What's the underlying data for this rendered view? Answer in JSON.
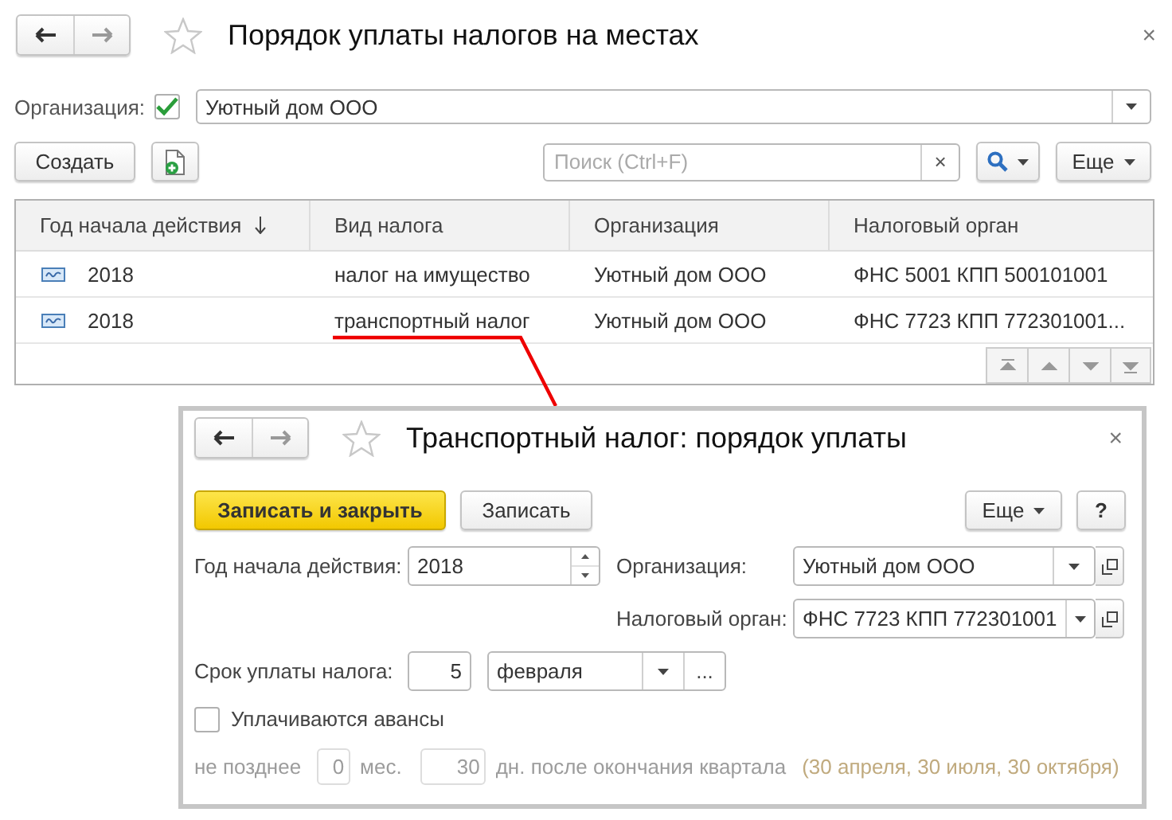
{
  "window": {
    "title": "Порядок уплаты налогов на местах",
    "close": "×"
  },
  "filter": {
    "label": "Организация:",
    "checked": true,
    "value": "Уютный дом ООО"
  },
  "toolbar": {
    "create_button": "Создать",
    "search": {
      "placeholder": "Поиск (Ctrl+F)",
      "clear": "×"
    },
    "more_button": "Еще"
  },
  "table": {
    "columns": [
      {
        "label": "Год начала действия",
        "sorted": true
      },
      {
        "label": "Вид налога",
        "sorted": false
      },
      {
        "label": "Организация",
        "sorted": false
      },
      {
        "label": "Налоговый орган",
        "sorted": false
      }
    ],
    "rows": [
      {
        "selected": false,
        "cells": [
          "2018",
          "налог на имущество",
          "Уютный дом ООО",
          "ФНС 5001 КПП 500101001"
        ]
      },
      {
        "selected": false,
        "cells": [
          "2018",
          "транспортный налог",
          "Уютный дом ООО",
          "ФНС 7723 КПП 772301001..."
        ]
      }
    ]
  },
  "dialog": {
    "title": "Транспортный налог: порядок уплаты",
    "close": "×",
    "save_close_button": "Записать и закрыть",
    "save_button": "Записать",
    "more_button": "Еще",
    "help_button": "?",
    "year": {
      "label": "Год начала действия:",
      "value": "2018"
    },
    "organization": {
      "label": "Организация:",
      "value": "Уютный дом ООО"
    },
    "tax_authority": {
      "label": "Налоговый орган:",
      "value": "ФНС 7723 КПП 772301001"
    },
    "deadline": {
      "label": "Срок уплаты налога:",
      "day": "5",
      "month": "февраля",
      "select_button": "..."
    },
    "advances": {
      "label": "Уплачиваются авансы",
      "checked": false
    },
    "advance_terms": {
      "disabled": true,
      "prefix": "не позднее",
      "months": "0",
      "months_unit": "мес.",
      "days": "30",
      "days_suffix": "дн. после окончания квартала",
      "hint": "(30 апреля, 30 июля, 30 октября)"
    }
  }
}
